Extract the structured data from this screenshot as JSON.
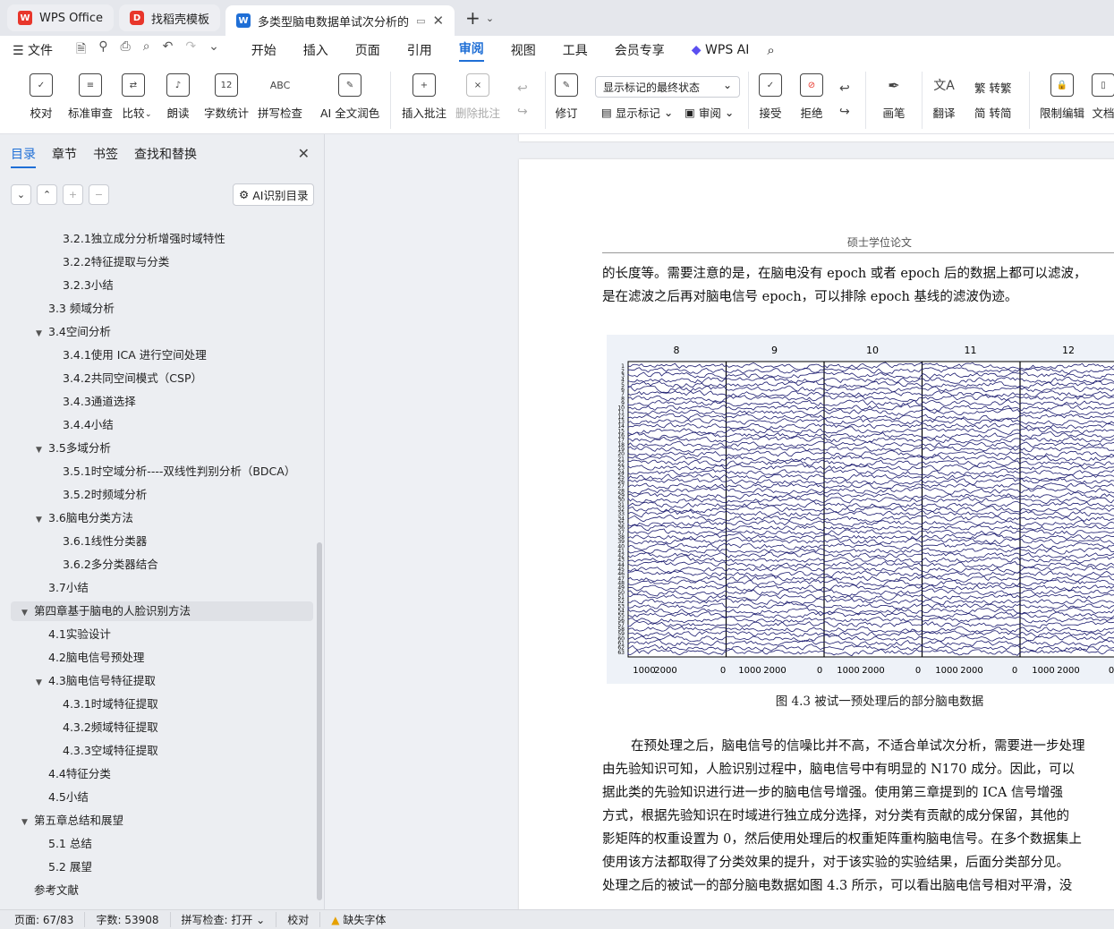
{
  "tabs": [
    {
      "label": "WPS Office",
      "icon": "wps-logo-icon"
    },
    {
      "label": "找稻壳模板",
      "icon": "docer-icon"
    },
    {
      "label": "多类型脑电数据单试次分析的",
      "icon": "word-doc-icon"
    }
  ],
  "menu": {
    "file": "文件",
    "items": [
      "开始",
      "插入",
      "页面",
      "引用",
      "审阅",
      "视图",
      "工具",
      "会员专享"
    ],
    "active": "审阅",
    "wps_ai": "WPS AI"
  },
  "ribbon": {
    "proofread": "校对",
    "standard_review": "标准审查",
    "compare": "比较",
    "read_aloud": "朗读",
    "word_count": "字数统计",
    "spell_check": "拼写检查",
    "ai_polish": "AI 全文润色",
    "insert_comment": "插入批注",
    "delete_comment": "删除批注",
    "revise": "修订",
    "markup_select": "显示标记的最终状态",
    "show_markup": "显示标记",
    "review": "审阅",
    "accept": "接受",
    "reject": "拒绝",
    "pen": "画笔",
    "translate": "翻译",
    "to_trad": "转繁",
    "to_simp": "转简",
    "restrict": "限制编辑",
    "doc": "文档"
  },
  "panel": {
    "tabs": [
      "目录",
      "章节",
      "书签",
      "查找和替换"
    ],
    "ai_toc": "AI识别目录"
  },
  "toc": [
    {
      "label": "3.2.1独立成分分析增强时域特性",
      "level": 3
    },
    {
      "label": "3.2.2特征提取与分类",
      "level": 3
    },
    {
      "label": "3.2.3小结",
      "level": 3
    },
    {
      "label": "3.3  频域分析",
      "level": 2
    },
    {
      "label": "3.4空间分析",
      "level": 2,
      "expanded": true
    },
    {
      "label": "3.4.1使用 ICA 进行空间处理",
      "level": 3
    },
    {
      "label": "3.4.2共同空间模式（CSP）",
      "level": 3
    },
    {
      "label": "3.4.3通道选择",
      "level": 3
    },
    {
      "label": "3.4.4小结",
      "level": 3
    },
    {
      "label": "3.5多域分析",
      "level": 2,
      "expanded": true
    },
    {
      "label": "3.5.1时空域分析----双线性判别分析（BDCA）",
      "level": 3
    },
    {
      "label": "3.5.2时频域分析",
      "level": 3
    },
    {
      "label": "3.6脑电分类方法",
      "level": 2,
      "expanded": true
    },
    {
      "label": "3.6.1线性分类器",
      "level": 3
    },
    {
      "label": "3.6.2多分类器结合",
      "level": 3
    },
    {
      "label": "3.7小结",
      "level": 2
    },
    {
      "label": "第四章基于脑电的人脸识别方法",
      "level": 1,
      "expanded": true,
      "selected": true
    },
    {
      "label": "4.1实验设计",
      "level": 2
    },
    {
      "label": "4.2脑电信号预处理",
      "level": 2
    },
    {
      "label": "4.3脑电信号特征提取",
      "level": 2,
      "expanded": true
    },
    {
      "label": "4.3.1时域特征提取",
      "level": 3
    },
    {
      "label": "4.3.2频域特征提取",
      "level": 3
    },
    {
      "label": "4.3.3空域特征提取",
      "level": 3
    },
    {
      "label": "4.4特征分类",
      "level": 2
    },
    {
      "label": "4.5小结",
      "level": 2
    },
    {
      "label": "第五章总结和展望",
      "level": 1,
      "expanded": true
    },
    {
      "label": "5.1  总结",
      "level": 2
    },
    {
      "label": "5.2  展望",
      "level": 2
    },
    {
      "label": "参考文献",
      "level": 1
    }
  ],
  "document": {
    "header": "硕士学位论文",
    "para1": [
      "的长度等。需要注意的是，在脑电没有 epoch 或者 epoch 后的数据上都可以滤波，",
      "是在滤波之后再对脑电信号 epoch，可以排除 epoch 基线的滤波伪迹。"
    ],
    "figure": {
      "epochs": [
        "8",
        "9",
        "10",
        "11",
        "12"
      ],
      "x_ticks": [
        "1000",
        "2000",
        "0",
        "1000",
        "2000",
        "0",
        "1000",
        "2000",
        "0",
        "1000",
        "2000",
        "0",
        "1000",
        "2000",
        "0"
      ],
      "channels": [
        "1",
        "2",
        "3",
        "4",
        "5",
        "6",
        "7",
        "8",
        "9",
        "10",
        "11",
        "12",
        "13",
        "14",
        "15",
        "16",
        "17",
        "18",
        "19",
        "20",
        "21",
        "22",
        "23",
        "24",
        "25",
        "26",
        "27",
        "28",
        "29",
        "30",
        "31",
        "32",
        "33",
        "34",
        "35",
        "36",
        "37",
        "38",
        "39",
        "40",
        "41",
        "42",
        "43",
        "44",
        "45",
        "46",
        "47",
        "48",
        "49",
        "50",
        "51",
        "52",
        "53",
        "54",
        "55",
        "56",
        "57",
        "58",
        "59",
        "60",
        "61",
        "62",
        "63"
      ],
      "trace_color": "#1a1a6e"
    },
    "caption": "图 4.3  被试一预处理后的部分脑电数据",
    "para2": [
      "在预处理之后，脑电信号的信噪比并不高，不适合单试次分析，需要进一步处理",
      "由先验知识可知，人脸识别过程中，脑电信号中有明显的 N170 成分。因此，可以",
      "据此类的先验知识进行进一步的脑电信号增强。使用第三章提到的 ICA 信号增强",
      "方式，根据先验知识在时域进行独立成分选择，对分类有贡献的成分保留，其他的",
      "影矩阵的权重设置为 0，然后使用处理后的权重矩阵重构脑电信号。在多个数据集上",
      "使用该方法都取得了分类效果的提升，对于该实验的实验结果，后面分类部分见。",
      "处理之后的被试一的部分脑电数据如图 4.3 所示，可以看出脑电信号相对平滑，没"
    ]
  },
  "status": {
    "page": "页面: 67/83",
    "words": "字数: 53908",
    "spell": "拼写检查: 打开",
    "proof": "校对",
    "missing_font": "缺失字体"
  },
  "colors": {
    "accent": "#1f6fd6",
    "wps_red": "#e8362b"
  }
}
